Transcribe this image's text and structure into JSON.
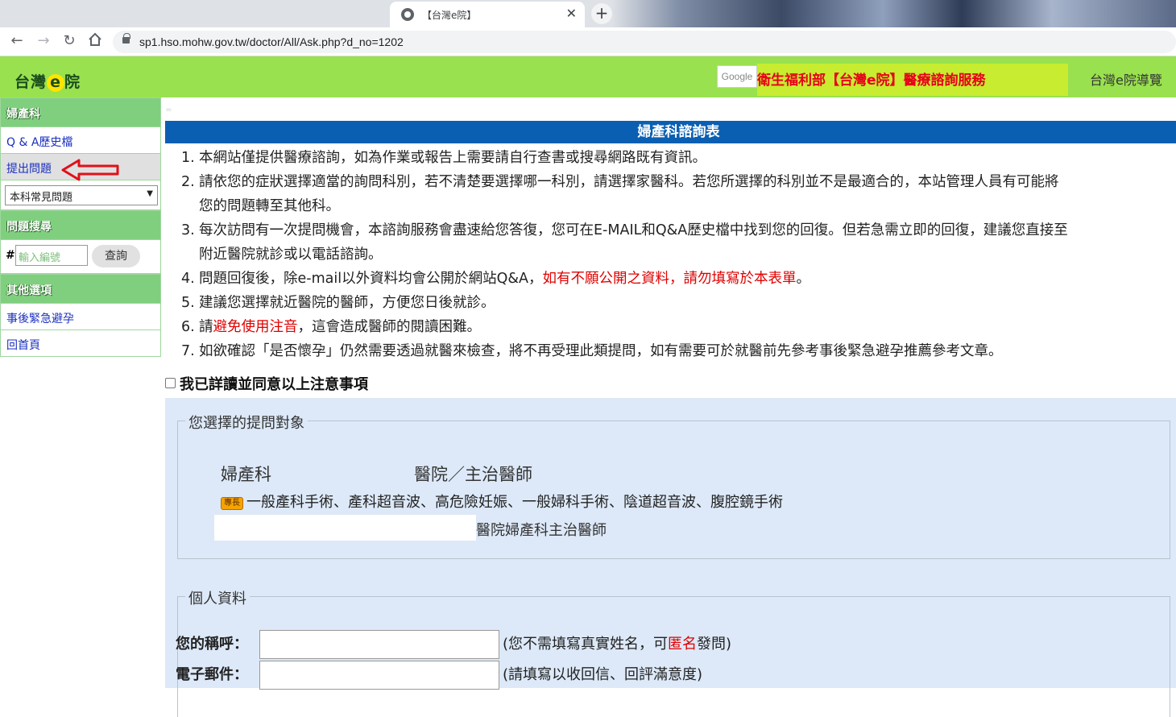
{
  "browser": {
    "tab_title": "【台灣e院】",
    "tab_close": "✕",
    "new_tab": "+",
    "url": "sp1.hso.mohw.gov.tw/doctor/All/Ask.php?d_no=1202"
  },
  "header": {
    "logo_a": "台灣",
    "logo_e": "e",
    "logo_b": "院",
    "google_label": "Google",
    "banner": "衛生福利部【台灣e院】醫療諮詢服務",
    "guide": "台灣e院導覽"
  },
  "sidebar": {
    "section1_title": "婦產科",
    "qa_history": "Q & A歷史檔",
    "ask_question": "提出問題",
    "faq_select": "本科常見問題",
    "section2_title": "問題搜尋",
    "hash": "#",
    "search_placeholder": "輸入編號",
    "search_button": "查詢",
    "section3_title": "其他選項",
    "emergency": "事後緊急避孕",
    "home": "回首頁"
  },
  "main": {
    "form_title": "婦產科諮詢表",
    "notes": [
      {
        "num": "1.",
        "text": "本網站僅提供醫療諮詢，如為作業或報告上需要請自行查書或搜尋網路既有資訊。"
      },
      {
        "num": "2.",
        "text": "請依您的症狀選擇適當的詢問科別，若不清楚要選擇哪一科別，請選擇家醫科。若您所選擇的科別並不是最適合的，本站管理人員有可能將"
      },
      {
        "num": "",
        "text": "您的問題轉至其他科。"
      },
      {
        "num": "3.",
        "text": "每次訪問有一次提問機會，本諮詢服務會盡速給您答復，您可在E-MAIL和Q&A歷史檔中找到您的回復。但若急需立即的回復，建議您直接至"
      },
      {
        "num": "",
        "text": "附近醫院就診或以電話諮詢。"
      }
    ],
    "note4_a": "問題回復後，除e-mail以外資料均會公開於網站Q&A，",
    "note4_red": "如有不願公開之資料，請勿填寫於本表單",
    "note4_b": "。",
    "note5": "建議您選擇就近醫院的醫師，方便您日後就診。",
    "note6_a": "請",
    "note6_red": "避免使用注音",
    "note6_b": "，這會造成醫師的閱讀困難。",
    "note7": "如欲確認「是否懷孕」仍然需要透過就醫來檢查，將不再受理此類提問，如有需要可於就醫前先參考事後緊急避孕推薦參考文章。",
    "num4": "4.",
    "num5": "5.",
    "num6": "6.",
    "num7": "7.",
    "agree": "我已詳讀並同意以上注意事項"
  },
  "doctor_section": {
    "legend": "您選擇的提問對象",
    "dept": "婦產科",
    "hospital_suffix": "醫院／主治醫師",
    "specialty_badge": "專長",
    "specialty": "一般產科手術、產科超音波、高危險妊娠、一般婦科手術、陰道超音波、腹腔鏡手術",
    "title": "醫院婦產科主治醫師"
  },
  "personal_section": {
    "legend": "個人資料",
    "nickname_label": "您的稱呼：",
    "nickname_hint_a": "(您不需填寫真實姓名，可",
    "nickname_hint_red": "匿名",
    "nickname_hint_b": "發問)",
    "email_label": "電子郵件：",
    "email_hint": "(請填寫以收回信、回評滿意度)"
  }
}
